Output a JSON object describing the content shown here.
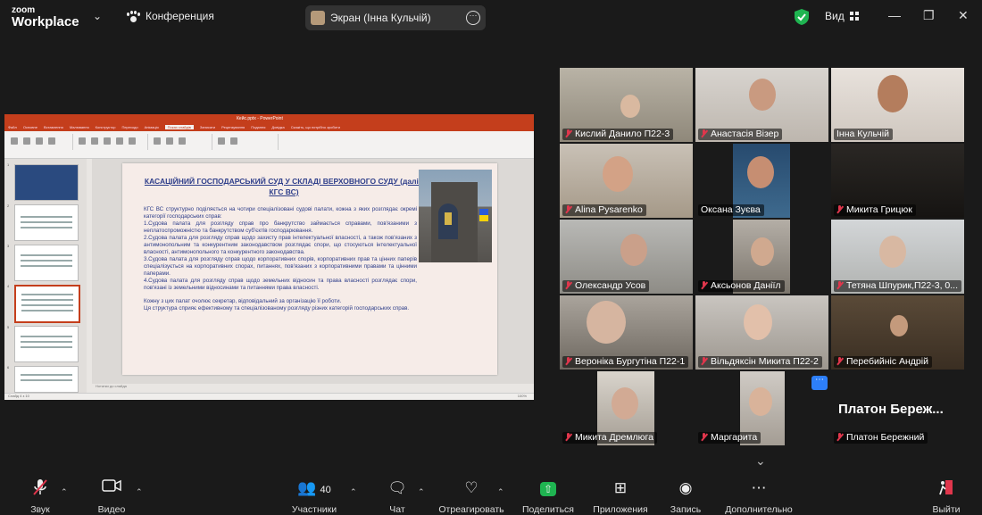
{
  "topbar": {
    "logo_top": "zoom",
    "logo_bottom": "Workplace",
    "meeting_title": "Конференция",
    "screen_share_label": "Экран (Інна Кульчій)",
    "view_label": "Вид"
  },
  "share": {
    "app_title": "Кейс.pptx - PowerPoint",
    "tabs": [
      "Файл",
      "Основне",
      "Вставлення",
      "Малювання",
      "Конструктор",
      "Переходи",
      "Анімація",
      "Показ слайдів",
      "Записати",
      "Рецензування",
      "Подання",
      "Довідка",
      "Скажіть, що потрібно зробити"
    ],
    "active_tab": "Показ слайдів",
    "notes_placeholder": "Нотатки до слайда",
    "status_left": "Слайд 4 з 10",
    "status_zoom": "100%",
    "slide": {
      "title": "КАСАЦІЙНИЙ ГОСПОДАРСЬКИЙ СУД У СКЛАДІ ВЕРХОВНОГО СУДУ (далі - КГС ВС)",
      "paragraphs": [
        "КГС ВС структурно поділяється на чотири спеціалізовані судові палати, кожна з яких розглядає окремі категорії господарських справ:",
        "1.Судова палата для розгляду справ про банкрутство займається справами, пов'язаними з неплатоспроможністю та банкрутством суб'єктів господарювання.",
        "2.Судова палата для розгляду справ щодо захисту прав інтелектуальної власності, а також пов'язаних з антимонопольним та конкурентним законодавством розглядає спори, що стосуються інтелектуальної власності, антимонопольного та конкурентного законодавства.",
        "3.Судова палата для розгляду справ щодо корпоративних спорів, корпоративних прав та цінних паперів спеціалізується на корпоративних спорах, питаннях, пов'язаних з корпоративними правами та цінними паперами.",
        "4.Судова палата для розгляду справ щодо земельних відносин та права власності розглядає спори, пов'язані із земельними відносинами та питаннями права власності."
      ],
      "closing": [
        "Кожну з цих палат очолює секретар, відповідальний за організацію її роботи.",
        "Ця структура сприяє ефективному та спеціалізованому розгляду різних категорій господарських справ."
      ]
    }
  },
  "participants": [
    {
      "name": "Кислий Данило П22-3",
      "muted": true
    },
    {
      "name": "Анастасія Візер",
      "muted": true
    },
    {
      "name": "Інна Кульчій",
      "muted": false,
      "active": true
    },
    {
      "name": "Alina Pysarenko",
      "muted": true
    },
    {
      "name": "Оксана Зуєва",
      "muted": false
    },
    {
      "name": "Микита Грицюк",
      "muted": true
    },
    {
      "name": "Олександр Усов",
      "muted": true
    },
    {
      "name": "Аксьонов Даніїл",
      "muted": true
    },
    {
      "name": "Тетяна Шпурик,П22-3, 0...",
      "muted": true
    },
    {
      "name": "Вероніка Бургутіна П22-1",
      "muted": true
    },
    {
      "name": "Вільдяксін Микита П22-2",
      "muted": true
    },
    {
      "name": "Перебийніс Андрій",
      "muted": true
    },
    {
      "name": "Микита Дремлюга",
      "muted": true
    },
    {
      "name": "Маргарита",
      "muted": true
    },
    {
      "name": "Платон Бережний",
      "muted": true,
      "big_label": "Платон Береж..."
    }
  ],
  "toolbar": {
    "audio": "Звук",
    "video": "Видео",
    "participants": "Участники",
    "participants_count": "40",
    "chat": "Чат",
    "react": "Отреагировать",
    "share": "Поделиться",
    "apps": "Приложения",
    "record": "Запись",
    "more": "Дополнительно",
    "leave": "Выйти"
  },
  "colors": {
    "accent_green": "#1fb451",
    "active_speaker_border": "#2ea56b",
    "mute_red": "#e0364c",
    "ppt_red": "#c43e1c",
    "slide_text": "#2e3e8a"
  }
}
